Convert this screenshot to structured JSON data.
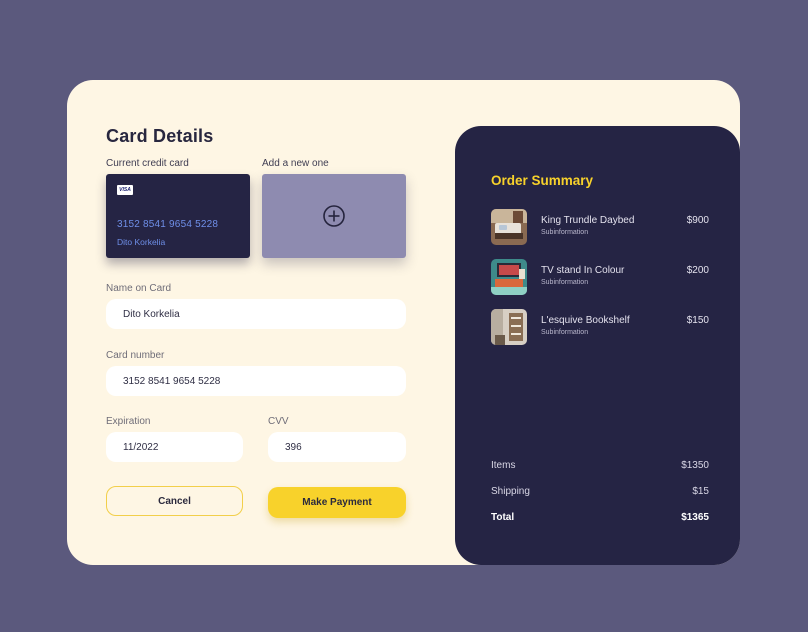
{
  "card_details": {
    "title": "Card Details",
    "current_card_label": "Current credit card",
    "add_new_label": "Add a new one",
    "card": {
      "brand": "VISA",
      "number": "3152 8541 9654 5228",
      "holder": "Dito Korkelia"
    },
    "name_label": "Name on Card",
    "name_value": "Dito Korkelia",
    "number_label": "Card number",
    "number_value": "3152 8541 9654 5228",
    "expiration_label": "Expiration",
    "expiration_value": "11/2022",
    "cvv_label": "CVV",
    "cvv_value": "396",
    "cancel_label": "Cancel",
    "pay_label": "Make Payment"
  },
  "order_summary": {
    "title": "Order Summary",
    "items": [
      {
        "name": "King Trundle Daybed",
        "sub": "Subinformation",
        "price": "$900",
        "icon": "daybed-thumbnail"
      },
      {
        "name": "TV stand In Colour",
        "sub": "Subinformation",
        "price": "$200",
        "icon": "tv-stand-thumbnail"
      },
      {
        "name": "L'esquive Bookshelf",
        "sub": "Subinformation",
        "price": "$150",
        "icon": "bookshelf-thumbnail"
      }
    ],
    "items_label": "Items",
    "items_value": "$1350",
    "shipping_label": "Shipping",
    "shipping_value": "$15",
    "total_label": "Total",
    "total_value": "$1365"
  },
  "colors": {
    "background": "#5b597d",
    "panel": "#fef6e4",
    "summary": "#252444",
    "accent": "#f8d22b",
    "card_text": "#6f8fe9",
    "add_card": "#8e8bb0"
  }
}
